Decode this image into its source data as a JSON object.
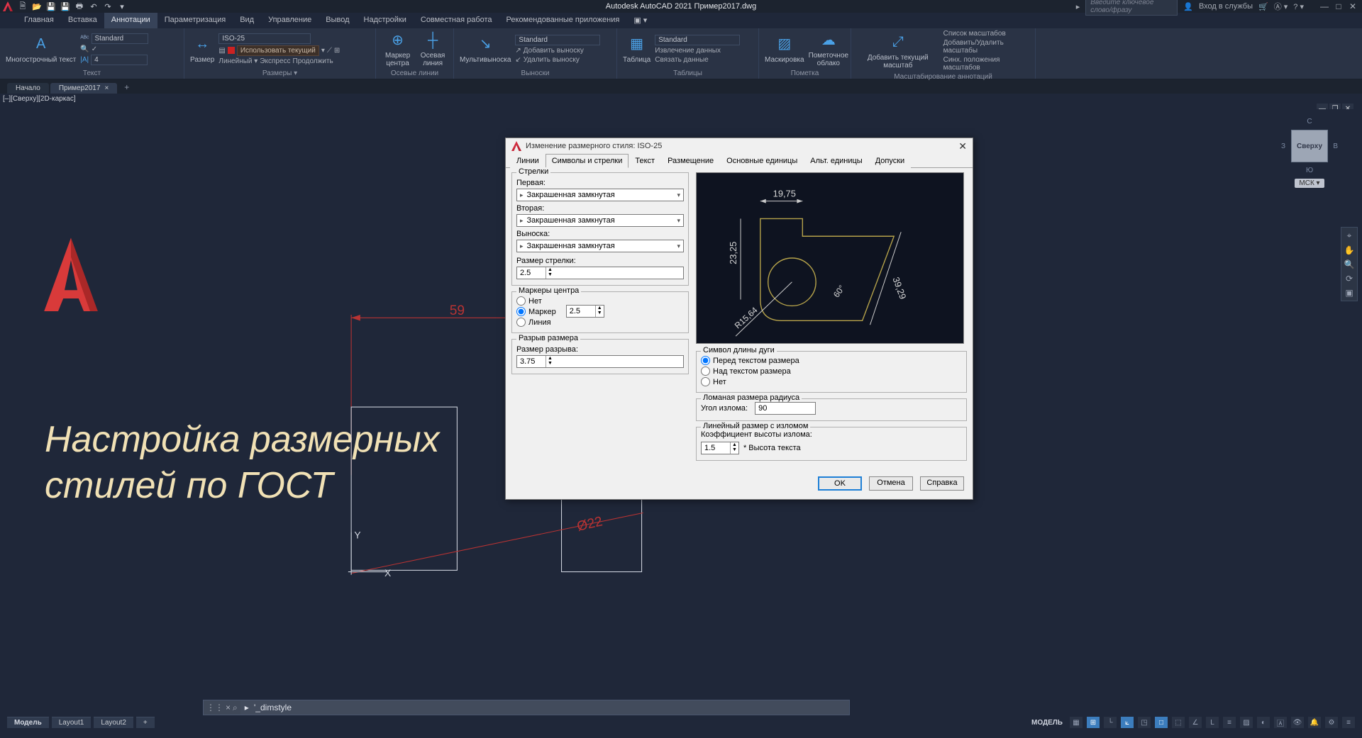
{
  "app": {
    "title": "Autodesk AutoCAD 2021   Пример2017.dwg",
    "search_placeholder": "Введите ключевое слово/фразу",
    "signin": "Вход в службы"
  },
  "menubar": [
    "Главная",
    "Вставка",
    "Аннотации",
    "Параметризация",
    "Вид",
    "Управление",
    "Вывод",
    "Надстройки",
    "Совместная работа",
    "Рекомендованные приложения"
  ],
  "ribbon": {
    "text": {
      "title": "Текст",
      "big": "Многострочный текст",
      "style": "Standard",
      "size": "4"
    },
    "dims": {
      "title": "Размеры ▾",
      "big": "Размер",
      "style": "ISO-25",
      "use": "Использовать текущий",
      "linear": "Линейный ▾",
      "quick": "Экспресс",
      "continue": "Продолжить"
    },
    "center": {
      "title": "Осевые линии",
      "marker": "Маркер центра",
      "cline": "Осевая линия"
    },
    "leaders": {
      "title": "Выноски",
      "big": "Мультивыноска",
      "style": "Standard",
      "add": "Добавить выноску",
      "del": "Удалить выноску"
    },
    "tables": {
      "title": "Таблицы",
      "big": "Таблица",
      "style": "Standard",
      "extract": "Извлечение данных",
      "link": "Связать данные"
    },
    "markup": {
      "title": "Пометка",
      "mask": "Маскировка",
      "cloud": "Пометочное облако"
    },
    "scale": {
      "title": "Масштабирование аннотаций",
      "add": "Добавить текущий масштаб",
      "list": "Список масштабов",
      "addrem": "Добавить/Удалить масштабы",
      "sync": "Синх. положения масштабов"
    }
  },
  "tabs": {
    "start": "Начало",
    "file": "Пример2017"
  },
  "view_label": "[–][Сверху][2D-каркас]",
  "caption_l1": "Настройка размерных",
  "caption_l2": "стилей по ГОСТ",
  "drawing": {
    "dim_h": "59",
    "dim_dia": "Ø22",
    "x": "X",
    "y": "Y"
  },
  "navcube": {
    "face": "Сверху",
    "n": "С",
    "s": "Ю",
    "w": "З",
    "e": "В",
    "wcs": "МСК ▾"
  },
  "cmdline": "'_dimstyle",
  "status": {
    "model": "Модель",
    "l1": "Layout1",
    "l2": "Layout2",
    "right": "МОДЕЛЬ"
  },
  "dialog": {
    "title": "Изменение размерного стиля: ISO-25",
    "tabs": [
      "Линии",
      "Символы и стрелки",
      "Текст",
      "Размещение",
      "Основные единицы",
      "Альт. единицы",
      "Допуски"
    ],
    "arrows": {
      "group": "Стрелки",
      "first": "Первая:",
      "second": "Вторая:",
      "leader": "Выноска:",
      "option": "Закрашенная замкнутая",
      "size": "Размер стрелки:",
      "size_val": "2.5"
    },
    "center_marks": {
      "group": "Маркеры центра",
      "none": "Нет",
      "mark": "Маркер",
      "line": "Линия",
      "val": "2.5"
    },
    "break": {
      "group": "Разрыв размера",
      "label": "Размер разрыва:",
      "val": "3.75"
    },
    "arc": {
      "group": "Символ длины дуги",
      "before": "Перед текстом размера",
      "above": "Над текстом размера",
      "none": "Нет"
    },
    "radius": {
      "group": "Ломаная размера радиуса",
      "angle": "Угол излома:",
      "val": "90"
    },
    "linjog": {
      "group": "Линейный размер с изломом",
      "coef": "Коэффициент высоты излома:",
      "val": "1.5",
      "suffix": "* Высота текста"
    },
    "preview": {
      "d1": "19,75",
      "d2": "23,25",
      "d3": "39,29",
      "ang": "60°",
      "r": "R15,64"
    },
    "ok": "OK",
    "cancel": "Отмена",
    "help": "Справка"
  }
}
